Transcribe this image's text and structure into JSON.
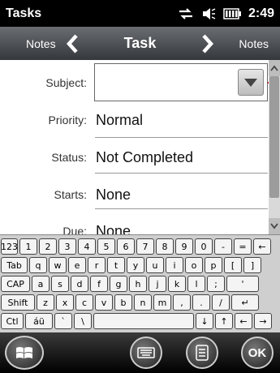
{
  "status": {
    "app_title": "Tasks",
    "time": "2:49"
  },
  "nav": {
    "left_label": "Notes",
    "title": "Task",
    "right_label": "Notes"
  },
  "form": {
    "subject_label": "Subject:",
    "subject_value": "",
    "priority_label": "Priority:",
    "priority_value": "Normal",
    "status_label": "Status:",
    "status_value": "Not Completed",
    "starts_label": "Starts:",
    "starts_value": "None",
    "due_label": "Due:",
    "due_value": "None"
  },
  "keyboard": {
    "rows": [
      [
        "123",
        "1",
        "2",
        "3",
        "4",
        "5",
        "6",
        "7",
        "8",
        "9",
        "0",
        "-",
        "=",
        "←"
      ],
      [
        "Tab",
        "q",
        "w",
        "e",
        "r",
        "t",
        "y",
        "u",
        "i",
        "o",
        "p",
        "[",
        "]"
      ],
      [
        "CAP",
        "a",
        "s",
        "d",
        "f",
        "g",
        "h",
        "j",
        "k",
        "l",
        ";",
        "'"
      ],
      [
        "Shift",
        "z",
        "x",
        "c",
        "v",
        "b",
        "n",
        "m",
        ",",
        ".",
        "/",
        "↵"
      ],
      [
        "Ctl",
        "áü",
        "`",
        "\\",
        "",
        "↓",
        "↑",
        "←",
        "→"
      ]
    ]
  },
  "bottom": {
    "ok_label": "OK"
  }
}
